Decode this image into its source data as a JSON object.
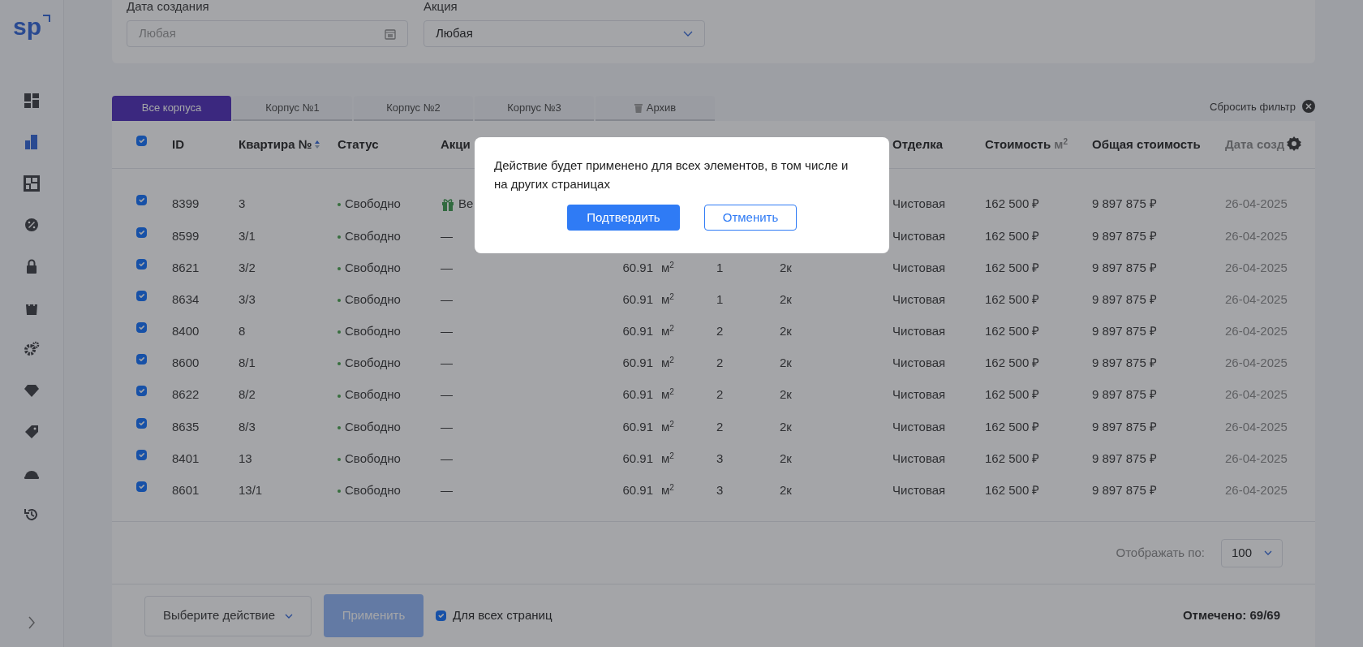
{
  "logo": "sp",
  "sidebar": {
    "items": [
      {
        "selected": false
      },
      {
        "selected": true
      },
      {
        "selected": false
      },
      {
        "selected": false
      },
      {
        "selected": false
      },
      {
        "selected": false
      },
      {
        "selected": false
      },
      {
        "selected": false
      },
      {
        "selected": false
      },
      {
        "selected": false
      },
      {
        "selected": false
      }
    ]
  },
  "filters": [
    {
      "label": "Дата создания",
      "placeholder": "Любая",
      "kind": "date"
    },
    {
      "label": "Акция",
      "value": "Любая",
      "kind": "select"
    }
  ],
  "tabs": [
    {
      "label": "Все корпуса",
      "selected": true,
      "kind": "building"
    },
    {
      "label": "Корпус №1",
      "selected": false,
      "kind": "building"
    },
    {
      "label": "Корпус №2",
      "selected": false,
      "kind": "building"
    },
    {
      "label": "Корпус №3",
      "selected": false,
      "kind": "building"
    },
    {
      "label": "Архив",
      "selected": false,
      "kind": "archive"
    }
  ],
  "reset_filter": "Сбросить фильтр",
  "header": {
    "checked": true,
    "id": "ID",
    "flat": "Квартира №",
    "flat_sortable": true,
    "status": "Статус",
    "promo": "Акци",
    "finish": "Отделка",
    "price_m2": "Стоимость",
    "price_m2_unit": "м$^{2}$",
    "total": "Общая стоимость",
    "created": "Дата созд"
  },
  "rows": [
    {
      "checked": true,
      "id": "8399",
      "flat": "3",
      "status": "Свободно",
      "gift": true,
      "promo": "Ве",
      "finish": "Чистовая",
      "price_m2": "162 500 ₽",
      "total": "9 897 875 ₽",
      "created": "26-04-2025"
    },
    {
      "checked": true,
      "id": "8599",
      "flat": "3/1",
      "status": "Свободно",
      "gift": false,
      "promo": "—",
      "finish": "Чистовая",
      "price_m2": "162 500 ₽",
      "total": "9 897 875 ₽",
      "created": "26-04-2025"
    },
    {
      "checked": true,
      "id": "8621",
      "flat": "3/2",
      "status": "Свободно",
      "gift": false,
      "promo": "—",
      "area": "60.91",
      "unit": "м$^{2}$",
      "floor": "1",
      "rooms": "2к",
      "finish": "Чистовая",
      "price_m2": "162 500 ₽",
      "total": "9 897 875 ₽",
      "created": "26-04-2025"
    },
    {
      "checked": true,
      "id": "8634",
      "flat": "3/3",
      "status": "Свободно",
      "gift": false,
      "promo": "—",
      "area": "60.91",
      "unit": "м$^{2}$",
      "floor": "1",
      "rooms": "2к",
      "finish": "Чистовая",
      "price_m2": "162 500 ₽",
      "total": "9 897 875 ₽",
      "created": "26-04-2025"
    },
    {
      "checked": true,
      "id": "8400",
      "flat": "8",
      "status": "Свободно",
      "gift": false,
      "promo": "—",
      "area": "60.91",
      "unit": "м$^{2}$",
      "floor": "2",
      "rooms": "2к",
      "finish": "Чистовая",
      "price_m2": "162 500 ₽",
      "total": "9 897 875 ₽",
      "created": "26-04-2025"
    },
    {
      "checked": true,
      "id": "8600",
      "flat": "8/1",
      "status": "Свободно",
      "gift": false,
      "promo": "—",
      "area": "60.91",
      "unit": "м$^{2}$",
      "floor": "2",
      "rooms": "2к",
      "finish": "Чистовая",
      "price_m2": "162 500 ₽",
      "total": "9 897 875 ₽",
      "created": "26-04-2025"
    },
    {
      "checked": true,
      "id": "8622",
      "flat": "8/2",
      "status": "Свободно",
      "gift": false,
      "promo": "—",
      "area": "60.91",
      "unit": "м$^{2}$",
      "floor": "2",
      "rooms": "2к",
      "finish": "Чистовая",
      "price_m2": "162 500 ₽",
      "total": "9 897 875 ₽",
      "created": "26-04-2025"
    },
    {
      "checked": true,
      "id": "8635",
      "flat": "8/3",
      "status": "Свободно",
      "gift": false,
      "promo": "—",
      "area": "60.91",
      "unit": "м$^{2}$",
      "floor": "2",
      "rooms": "2к",
      "finish": "Чистовая",
      "price_m2": "162 500 ₽",
      "total": "9 897 875 ₽",
      "created": "26-04-2025"
    },
    {
      "checked": true,
      "id": "8401",
      "flat": "13",
      "status": "Свободно",
      "gift": false,
      "promo": "—",
      "area": "60.91",
      "unit": "м$^{2}$",
      "floor": "3",
      "rooms": "2к",
      "finish": "Чистовая",
      "price_m2": "162 500 ₽",
      "total": "9 897 875 ₽",
      "created": "26-04-2025"
    },
    {
      "checked": true,
      "id": "8601",
      "flat": "13/1",
      "status": "Свободно",
      "gift": false,
      "promo": "—",
      "area": "60.91",
      "unit": "м$^{2}$",
      "floor": "3",
      "rooms": "2к",
      "finish": "Чистовая",
      "price_m2": "162 500 ₽",
      "total": "9 897 875 ₽",
      "created": "26-04-2025"
    }
  ],
  "page_size": {
    "label": "Отображать по:",
    "value": "100"
  },
  "footer": {
    "action": {
      "placeholder": "Выберите действие"
    },
    "apply": {
      "label": "Применить",
      "disabled": true
    },
    "all_pages": {
      "label": "Для всех страниц",
      "checked": true
    },
    "selected_count": "Отмечено: 69/69"
  },
  "dialog": {
    "message": "Действие будет применено для всех элементов, в том числе и на других страницах",
    "confirm": "Подтвердить",
    "cancel": "Отменить"
  }
}
